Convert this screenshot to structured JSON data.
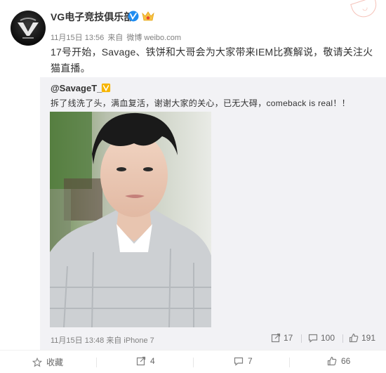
{
  "post": {
    "author": "VG电子竞技俱乐部",
    "time": "11月15日 13:56",
    "source_prefix": "来自",
    "source": "微博 weibo.com",
    "text": "17号开始，Savage、铁饼和大哥会为大家带来IEM比赛解说，敬请关注火猫直播。"
  },
  "repost": {
    "mention": "@SavageT_T",
    "text": "拆了线洗了头，满血复活，谢谢大家的关心，已无大碍，comeback is real！！",
    "time": "11月15日 13:48",
    "source_prefix": "来自",
    "source": "iPhone 7",
    "shares": "17",
    "comments": "100",
    "likes": "191"
  },
  "actions": {
    "favorite": "收藏",
    "share": "4",
    "comment": "7",
    "like": "66"
  },
  "colors": {
    "verified": "#1f8cf0",
    "text": "#333333",
    "meta": "#808080",
    "repost_bg": "#f2f2f5"
  },
  "icons": [
    "vg-logo-icon",
    "verified-icon",
    "crown-icon",
    "share-icon",
    "comment-icon",
    "like-icon",
    "favorite-icon"
  ]
}
